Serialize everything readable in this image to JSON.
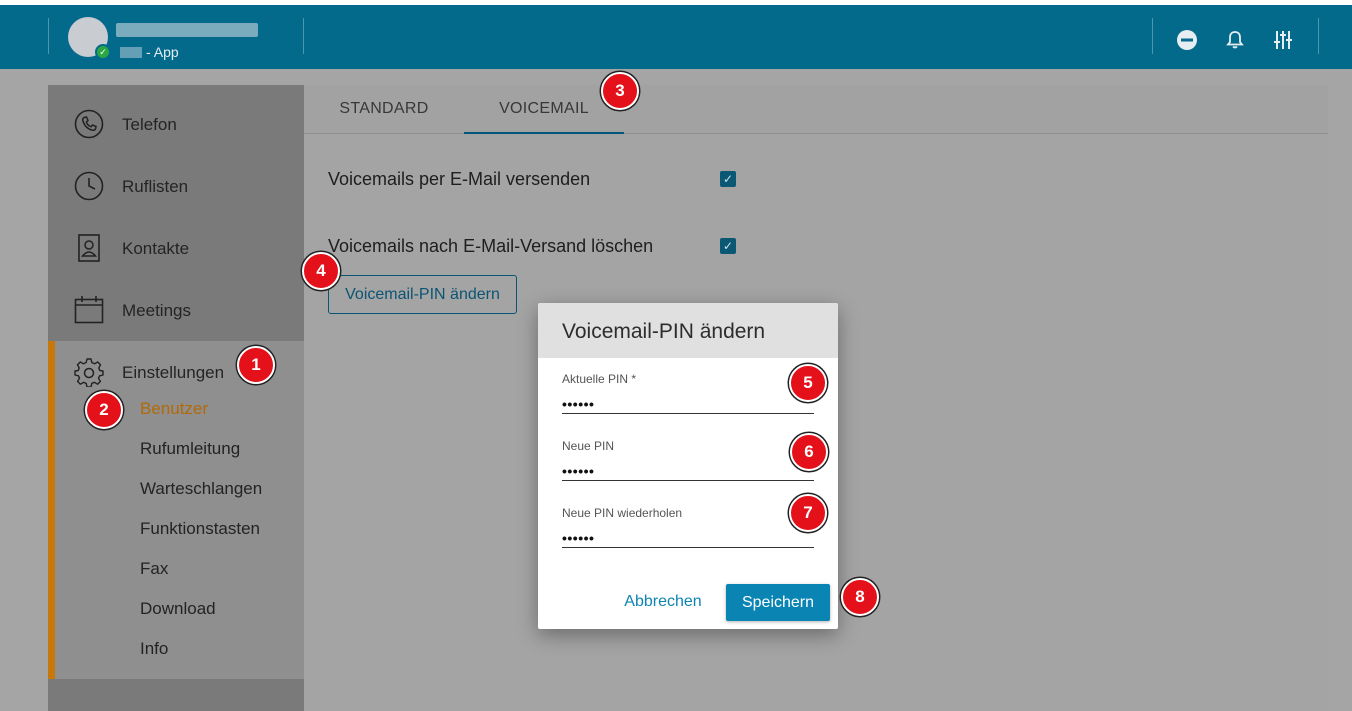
{
  "topbar": {
    "user_name": "",
    "app_label": "- App",
    "status": "online",
    "icons": [
      "do-not-disturb-icon",
      "bell-icon",
      "equalizer-icon"
    ]
  },
  "sidebar": {
    "items": [
      {
        "label": "Telefon",
        "icon": "phone-icon"
      },
      {
        "label": "Ruflisten",
        "icon": "clock-icon"
      },
      {
        "label": "Kontakte",
        "icon": "contact-card-icon"
      },
      {
        "label": "Meetings",
        "icon": "calendar-icon"
      },
      {
        "label": "Einstellungen",
        "icon": "gear-icon"
      }
    ],
    "sub_items": [
      "Benutzer",
      "Rufumleitung",
      "Warteschlangen",
      "Funktionstasten",
      "Fax",
      "Download",
      "Info"
    ],
    "active_sub": "Benutzer",
    "accent_color": "#c6780b"
  },
  "tabs": [
    {
      "label": "STANDARD",
      "active": false
    },
    {
      "label": "VOICEMAIL",
      "active": true
    }
  ],
  "voicemail": {
    "email_send": {
      "label": "Voicemails per E-Mail versenden",
      "checked": true
    },
    "delete_after": {
      "label": "Voicemails nach E-Mail-Versand löschen",
      "checked": true
    },
    "change_pin_button": "Voicemail-PIN ändern"
  },
  "dialog": {
    "title": "Voicemail-PIN ändern",
    "fields": [
      {
        "label": "Aktuelle PIN *",
        "value": "••••••"
      },
      {
        "label": "Neue PIN",
        "value": "••••••"
      },
      {
        "label": "Neue PIN wiederholen",
        "value": "••••••"
      }
    ],
    "cancel": "Abbrechen",
    "save": "Speichern"
  },
  "callouts": [
    "1",
    "2",
    "3",
    "4",
    "5",
    "6",
    "7",
    "8"
  ],
  "colors": {
    "topbar": "#036a8c",
    "badge": "#e4101a",
    "primary_button": "#0a85b3"
  }
}
